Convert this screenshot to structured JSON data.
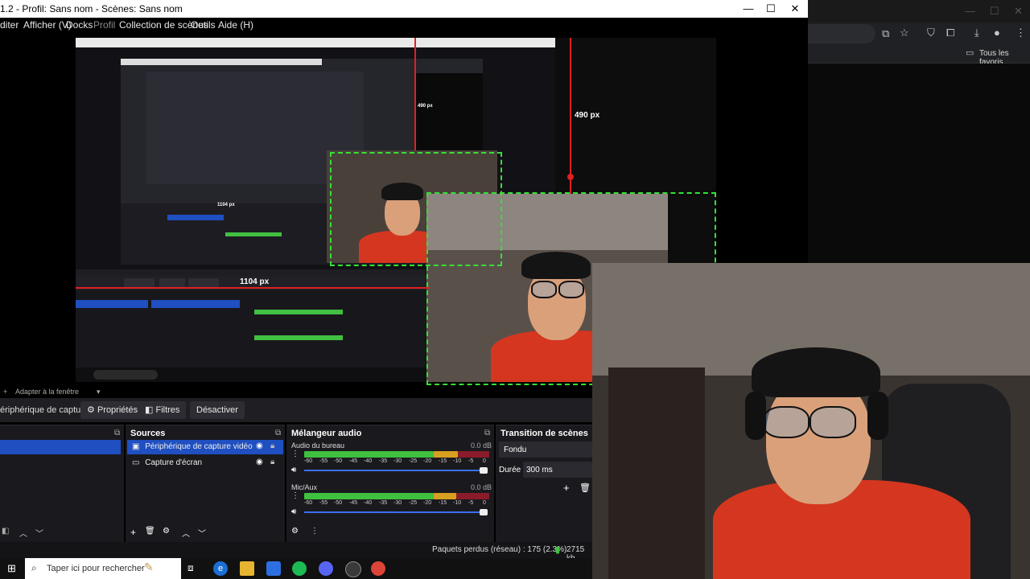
{
  "window": {
    "title": "1.2 - Profil: Sans nom - Scènes: Sans nom",
    "minimize": "—",
    "maximize": "☐",
    "close": "✕"
  },
  "menu": [
    "diter",
    "Afficher (V)",
    "Docks",
    "Profil",
    "Collection de scènes",
    "Outils",
    "Aide (H)"
  ],
  "browser": {
    "bookmarks_label": "Tous les favoris"
  },
  "preview": {
    "height_label": "490 px",
    "width_label": "1104 px",
    "nested_height_label": "490 px",
    "nested_width_label": "1104 px"
  },
  "adapter_label": "Adapter à la fenêtre",
  "props_toolbar": {
    "source_name": "ériphérique de capture vic",
    "properties": "Propriétés",
    "filters": "Filtres",
    "deactivate": "Désactiver"
  },
  "sources": {
    "title": "Sources",
    "items": [
      "Périphérique de capture vidéo",
      "Capture d'écran"
    ]
  },
  "mixer": {
    "title": "Mélangeur audio",
    "ticks": [
      "-60",
      "-55",
      "-50",
      "-45",
      "-40",
      "-35",
      "-30",
      "-25",
      "-20",
      "-15",
      "-10",
      "-5",
      "0"
    ],
    "channels": [
      {
        "name": "Audio du bureau",
        "db": "0.0 dB",
        "level": 0.83
      },
      {
        "name": "Mic/Aux",
        "db": "0.0 dB",
        "level": 0.82
      }
    ]
  },
  "transitions": {
    "title": "Transition de scènes",
    "type": "Fondu",
    "duration_label": "Durée",
    "duration_value": "300 ms"
  },
  "status": {
    "dropped": "Paquets perdus (réseau) : 175 (2.3%)",
    "bitrate": "2715 kb"
  },
  "taskbar": {
    "search_placeholder": "Taper ici pour rechercher"
  },
  "colors": {
    "selection": "#1f4fc0",
    "guide_red": "#e02020",
    "bbox_green": "#35e035",
    "shirt_red": "#d5361f"
  }
}
